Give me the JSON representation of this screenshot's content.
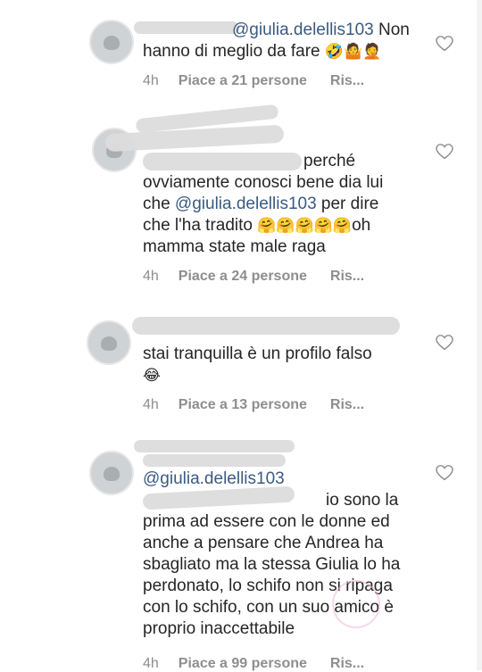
{
  "comments": [
    {
      "handle_visible": "",
      "mention": "@giulia.delellis103",
      "text": "Non hanno di meglio da fare",
      "emojis": "🤣🤷🤦",
      "time": "4h",
      "likes": "Piace a 21 persone",
      "reply": "Ris..."
    },
    {
      "handle_visible": "",
      "text_parts": [
        "perché ovviamente conosci bene dia lui che ",
        "@giulia.delellis103",
        " per dire che l'ha tradito "
      ],
      "emojis": "🤗🤗🤗🤗🤗",
      "tail": "oh mamma state male raga",
      "time": "4h",
      "likes": "Piace a 24 persone",
      "reply": "Ris..."
    },
    {
      "handle_visible": "",
      "text": "stai tranquilla è un profilo falso",
      "emojis": "😂",
      "time": "4h",
      "likes": "Piace a 13 persone",
      "reply": "Ris..."
    },
    {
      "handle_visible": "",
      "mention": "@giulia.delellis103",
      "text": "io sono la prima ad essere con le donne ed anche a pensare che Andrea ha sbagliato ma la stessa Giulia lo ha perdonato, lo schifo non si ripaga con lo schifo, con un suo amico è proprio inaccettabile",
      "time": "4h",
      "likes": "Piace a 99 persone",
      "reply": "Ris..."
    }
  ],
  "icons": {
    "like": "heart-outline-icon"
  },
  "colors": {
    "mention": "#3a5a80",
    "meta": "#8e8e8e",
    "text": "#262626"
  }
}
